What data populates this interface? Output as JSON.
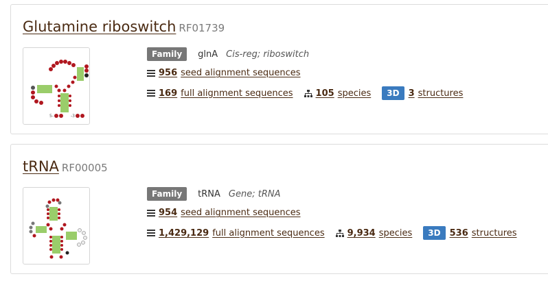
{
  "results": [
    {
      "title": "Glutamine riboswitch",
      "accession": "RF01739",
      "family_badge": "Family",
      "gene": "glnA",
      "type": "Cis-reg; riboswitch",
      "seed_count": "956",
      "seed_label": "seed alignment sequences",
      "full_count": "169",
      "full_label": "full alignment sequences",
      "species_count": "105",
      "species_label": "species",
      "badge_3d": "3D",
      "structures_count": "3",
      "structures_label": "structures"
    },
    {
      "title": "tRNA",
      "accession": "RF00005",
      "family_badge": "Family",
      "gene": "tRNA",
      "type": "Gene; tRNA",
      "seed_count": "954",
      "seed_label": "seed alignment sequences",
      "full_count": "1,429,129",
      "full_label": "full alignment sequences",
      "species_count": "9,934",
      "species_label": "species",
      "badge_3d": "3D",
      "structures_count": "536",
      "structures_label": "structures"
    }
  ],
  "colors": {
    "link": "#4a2a12",
    "family_badge": "#777777",
    "badge_3d": "#3a7bbf",
    "nucleotide_red": "#b0171f",
    "nucleotide_green": "#9acd6a"
  },
  "icons": [
    "list-icon",
    "species-tree-icon",
    "secondary-structure-thumbnail"
  ]
}
